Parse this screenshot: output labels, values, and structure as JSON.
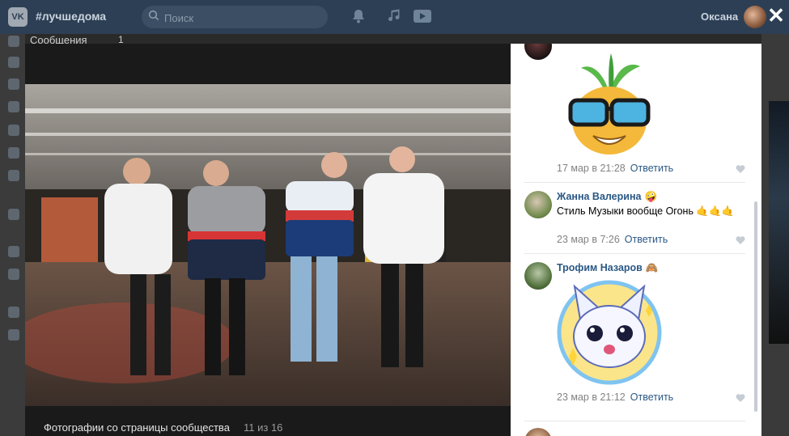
{
  "header": {
    "logo_text": "VK",
    "hashtag": "#лучшедома",
    "search_placeholder": "Поиск",
    "user_name": "Оксана",
    "close_symbol": "✕"
  },
  "background": {
    "messages_label": "Сообщения",
    "messages_count": "1"
  },
  "viewer": {
    "caption": "Фотографии со страницы сообщества",
    "counter": "11 из 16"
  },
  "comments": [
    {
      "name": "",
      "text": "",
      "date": "17 мар в 21:28",
      "reply": "Ответить",
      "sticker": "pineapple-sunglasses-sticker"
    },
    {
      "name": "Жанна Валерина",
      "name_emoji": "🤪",
      "text": "Стиль Музыки вообще Огонь 🤙🤙🤙",
      "date": "23 мар в 7:26",
      "reply": "Ответить"
    },
    {
      "name": "Трофим Назаров",
      "name_emoji": "🙈",
      "text": "",
      "date": "23 мар в 21:12",
      "reply": "Ответить",
      "sticker": "cat-sparkle-sticker"
    }
  ],
  "colors": {
    "topbar": "#2d3f55",
    "link": "#2a5885",
    "muted": "#828282"
  }
}
